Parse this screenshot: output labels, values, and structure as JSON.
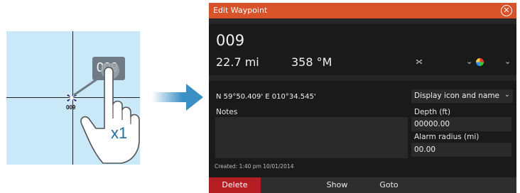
{
  "illustration": {
    "waypoint_label": "009",
    "popup_label": "009",
    "tap_count": "x1"
  },
  "dialog": {
    "title": "Edit Waypoint",
    "close_icon": "close-circle-icon",
    "name": "009",
    "distance": "22.7 mi",
    "bearing": "358 °M",
    "symbol_icon": "waypoint-symbol-icon",
    "color_icon": "color-wheel-icon",
    "position": "N 59°50.409'   E 010°34.545'",
    "display_option": "Display icon and name",
    "notes_label": "Notes",
    "notes_value": "",
    "depth_label": "Depth (ft)",
    "depth_value": "00000.00",
    "alarm_label": "Alarm radius (mi)",
    "alarm_value": "00.00",
    "created": "Created: 1:40 pm  10/01/2014",
    "buttons": {
      "delete": "Delete",
      "show": "Show",
      "goto": "Goto"
    },
    "colors": {
      "titlebar": "#d8532a",
      "background": "#1a1a1a",
      "delete": "#b41e22",
      "map": "#c9e8f8",
      "arrow": "#3a8fc4"
    }
  }
}
